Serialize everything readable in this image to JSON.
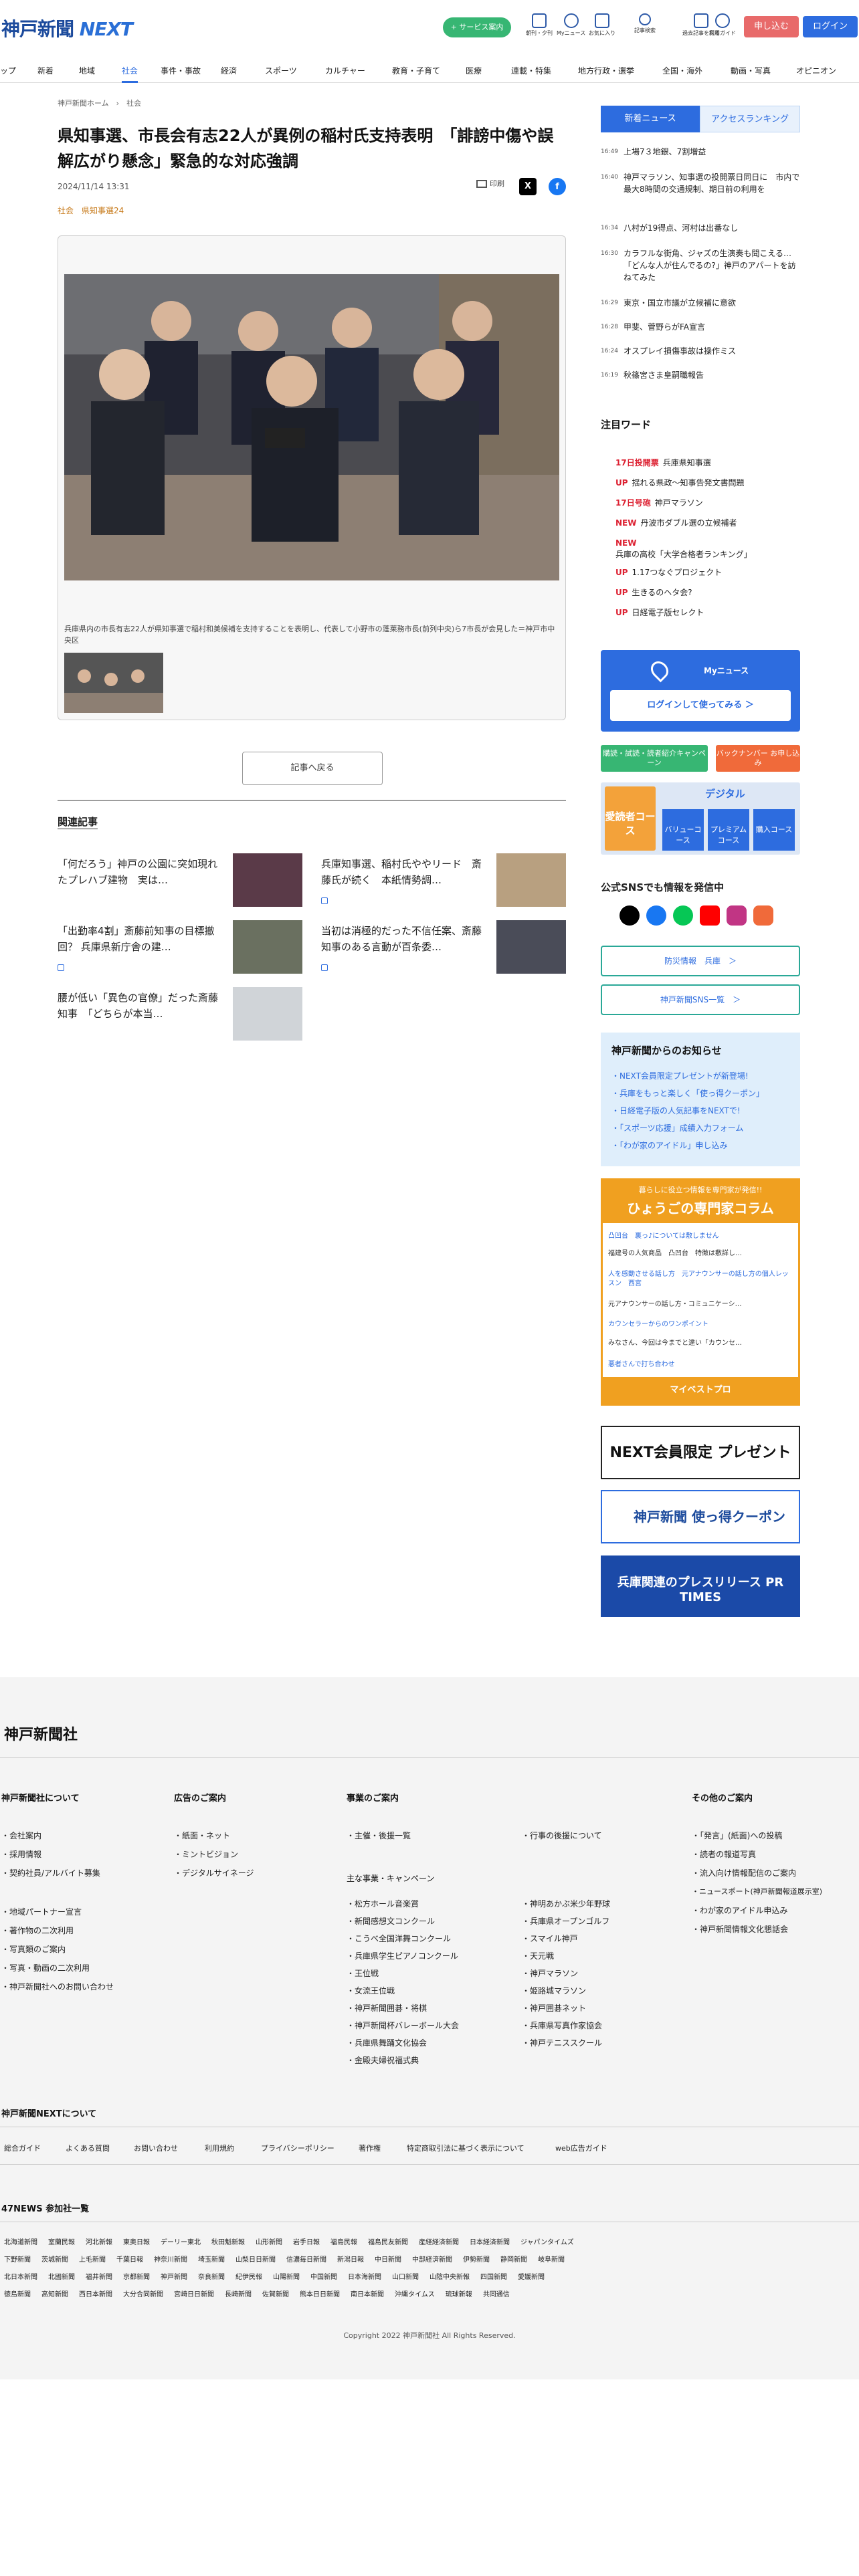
{
  "header": {
    "logo_main": "神戸新聞",
    "logo_next": "NEXT",
    "service_btn": "+ サービス案内",
    "icons": [
      {
        "name": "paper-icon",
        "label": "朝刊・夕刊"
      },
      {
        "name": "mynews-icon",
        "label": "Myニュース"
      },
      {
        "name": "bookmark-icon",
        "label": "お気に入り"
      },
      {
        "name": "search-icon",
        "label": "記事検索"
      },
      {
        "name": "archive-icon",
        "label": "過去記事を探る"
      },
      {
        "name": "help-icon",
        "label": "利用ガイド"
      }
    ],
    "subscribe": "申し込む",
    "login": "ログイン"
  },
  "nav": [
    "ップ",
    "新着",
    "地域",
    "社会",
    "事件・事故",
    "経済",
    "スポーツ",
    "カルチャー",
    "教育・子育て",
    "医療",
    "連載・特集",
    "地方行政・選挙",
    "全国・海外",
    "動画・写真",
    "オピニオン"
  ],
  "article": {
    "breadcrumb": "神戸新聞ホーム　›　社会",
    "title": "県知事選、市長会有志22人が異例の稲村氏支持表明　「誹謗中傷や誤解広がり懸念」緊急的な対応強調",
    "date": "2024/11/14 13:31",
    "tags": "社会　県知事選24",
    "print": "印刷",
    "caption": "兵庫県内の市長有志22人が県知事選で稲村和美候補を支持することを表明し、代表して小野市の蓬莱務市長(前列中央)ら7市長が会見した＝神戸市中央区",
    "back": "記事へ戻る"
  },
  "related": {
    "heading": "関連記事",
    "items": [
      "「何だろう」神戸の公園に突如現れたプレハブ建物　実は…",
      "兵庫知事選、稲村氏ややリード　斎藤氏が続く　本紙情勢調…",
      "「出勤率4割」斎藤前知事の目標撤回？ 兵庫県新庁舎の建…",
      "当初は消極的だった不信任案、斎藤知事のある言動が百条委…",
      "腰が低い「異色の官僚」だった斎藤知事　「どちらが本当…"
    ]
  },
  "sidebar": {
    "tab_new": "新着ニュース",
    "tab_rank": "アクセスランキング",
    "news": [
      {
        "time": "16:49",
        "title": "上場7３地銀、7割増益"
      },
      {
        "time": "16:40",
        "title": "神戸マラソン、知事選の投開票日同日に　市内で最大8時間の交通規制、期日前の利用を"
      },
      {
        "time": "16:34",
        "title": "八村が19得点、河村は出番なし"
      },
      {
        "time": "16:30",
        "title": "カラフルな街角、ジャズの生演奏も聞こえる…「どんな人が住んでるの?」神戸のアパートを訪ねてみた"
      },
      {
        "time": "16:29",
        "title": "東京・国立市議が立候補に意欲"
      },
      {
        "time": "16:28",
        "title": "甲斐、菅野らがFA宣言"
      },
      {
        "time": "16:24",
        "title": "オスプレイ損傷事故は操作ミス"
      },
      {
        "time": "16:19",
        "title": "秋篠宮さま皇嗣職報告"
      }
    ],
    "cue_heading": "注目ワード",
    "cues": [
      {
        "tag": "17日投開票",
        "word": "兵庫県知事選"
      },
      {
        "tag": "UP",
        "word": "揺れる県政～知事告発文書問題"
      },
      {
        "tag": "17日号砲",
        "word": "神戸マラソン"
      },
      {
        "tag": "NEW",
        "word": "丹波市ダブル選の立候補者"
      },
      {
        "tag": "NEW",
        "word": "兵庫の高校「大学合格者ランキング」"
      },
      {
        "tag": "UP",
        "word": "1.17つなぐプロジェクト"
      },
      {
        "tag": "UP",
        "word": "生きるのヘタ会?"
      },
      {
        "tag": "UP",
        "word": "日経電子版セレクト"
      }
    ],
    "my_title": "Myニュース",
    "my_login": "ログインして使ってみる ＞",
    "btn_green": "購読・試読・読者紹介キャンペーン",
    "btn_orange": "バックナンバー お申し込み",
    "digital": "デジタル",
    "digital_courses": [
      "バリューコース",
      "プレミアムコース",
      "購入コース"
    ],
    "print_course": "愛読者コース",
    "sns_heading": "公式SNSでも情報を発信中",
    "bousai": "防災情報　兵庫　＞",
    "snslist": "神戸新聞SNS一覧　＞",
    "notice_heading": "神戸新聞からのお知らせ",
    "notices": [
      "・NEXT会員限定プレゼントが新登場!",
      "・兵庫をもっと楽しく「使っ得クーポン」",
      "・日経電子版の人気記事をNEXTで!",
      "・「スポーツ応援」成績入力フォーム",
      "・「わが家のアイドル」申し込み"
    ],
    "hyogo_sub": "暮らしに役立つ情報を専門家が発信!!",
    "hyogo_title": "ひょうごの専門家コラム",
    "hyogo_items": [
      "凸凹台　裏っ♪については敷しません",
      "福建号の人気商品　凸凹台　特徴は敷詳し…",
      "人を感動させる話し方　元アナウンサーの話し方の個人レッスン　西宮",
      "元アナウンサーの話し方・コミュニケーシ…",
      "カウンセラーからのワンポイント",
      "みなさん、今回は今までと違い「カウンセ…",
      "悪者さんで打ち合わせ"
    ],
    "hyogo_btn": "マイベストプロ",
    "banner1": "NEXT会員限定 プレゼント",
    "banner2": "神戸新聞 使っ得クーポン",
    "banner3": "兵庫関連のプレスリリース PR TIMES"
  },
  "footer": {
    "logo": "神戸新聞社",
    "cols": [
      {
        "h": "神戸新聞社について",
        "items": [
          "・会社案内",
          "・採用情報",
          "・契約社員/アルバイト募集",
          "",
          "・地域パートナー宣言",
          "・著作物の二次利用",
          "・写真類のご案内",
          "・写真・動画の二次利用",
          "・神戸新聞社へのお問い合わせ"
        ]
      },
      {
        "h": "広告のご案内",
        "items": [
          "・紙面・ネット",
          "・ミントビジョン",
          "・デジタルサイネージ"
        ]
      },
      {
        "h": "事業のご案内",
        "items": [
          "・主催・後援一覧"
        ]
      },
      {
        "h": "",
        "items": [
          "・行事の後援について"
        ]
      },
      {
        "h": "その他のご案内",
        "items": [
          "・「発言」(紙面)への投稿",
          "・読者の報道写真",
          "・流入向け情報配信のご案内",
          "・ニュースポート(神戸新聞報道展示室)",
          "・わが家のアイドル申込み",
          "・神戸新聞情報文化懇話会"
        ]
      }
    ],
    "events_h": "主な事業・キャンペーン",
    "events_l": [
      "・松方ホール音楽賞",
      "・新聞感想文コンクール",
      "・こうべ全国洋舞コンクール",
      "・兵庫県学生ピアノコンクール",
      "・王位戦",
      "・女流王位戦",
      "・神戸新聞囲碁・将棋",
      "・神戸新聞杯バレーボール大会",
      "・兵庫県舞踊文化協会",
      "・金殿夫婦祝福式典"
    ],
    "events_r": [
      "・神明あかぶ米少年野球",
      "・兵庫県オープンゴルフ",
      "・スマイル神戸",
      "・天元戦",
      "・神戸マラソン",
      "・姫路城マラソン",
      "・神戸囲碁ネット",
      "・兵庫県写真作家協会",
      "・神戸テニススクール"
    ],
    "next_h": "神戸新聞NEXTについて",
    "next_links": [
      "総合ガイド",
      "よくある質問",
      "お問い合わせ",
      "利用規約",
      "プライバシーポリシー",
      "著作権",
      "特定商取引法に基づく表示について",
      "web広告ガイド"
    ],
    "n47_h": "47NEWS 参加社一覧",
    "n47_rows": [
      [
        "北海道新聞",
        "室蘭民報",
        "河北新報",
        "東奥日報",
        "デーリー東北",
        "秋田魁新報",
        "山形新聞",
        "岩手日報",
        "福島民報",
        "福島民友新聞",
        "産経経済新聞",
        "日本経済新聞",
        "ジャパンタイムズ"
      ],
      [
        "下野新聞",
        "茨城新聞",
        "上毛新聞",
        "千葉日報",
        "神奈川新聞",
        "埼玉新聞",
        "山梨日日新聞",
        "信濃毎日新聞",
        "新潟日報",
        "中日新聞",
        "中部経済新聞",
        "伊勢新聞",
        "静岡新聞",
        "岐阜新聞"
      ],
      [
        "北日本新聞",
        "北國新聞",
        "福井新聞",
        "京都新聞",
        "神戸新聞",
        "奈良新聞",
        "紀伊民報",
        "山陽新聞",
        "中国新聞",
        "日本海新聞",
        "山口新聞",
        "山陰中央新報",
        "四国新聞",
        "愛媛新聞"
      ],
      [
        "徳島新聞",
        "高知新聞",
        "西日本新聞",
        "大分合同新聞",
        "宮崎日日新聞",
        "長崎新聞",
        "佐賀新聞",
        "熊本日日新聞",
        "南日本新聞",
        "沖縄タイムス",
        "琉球新報",
        "共同通信"
      ]
    ],
    "copyright": "Copyright 2022 神戸新聞社 All Rights Reserved."
  }
}
